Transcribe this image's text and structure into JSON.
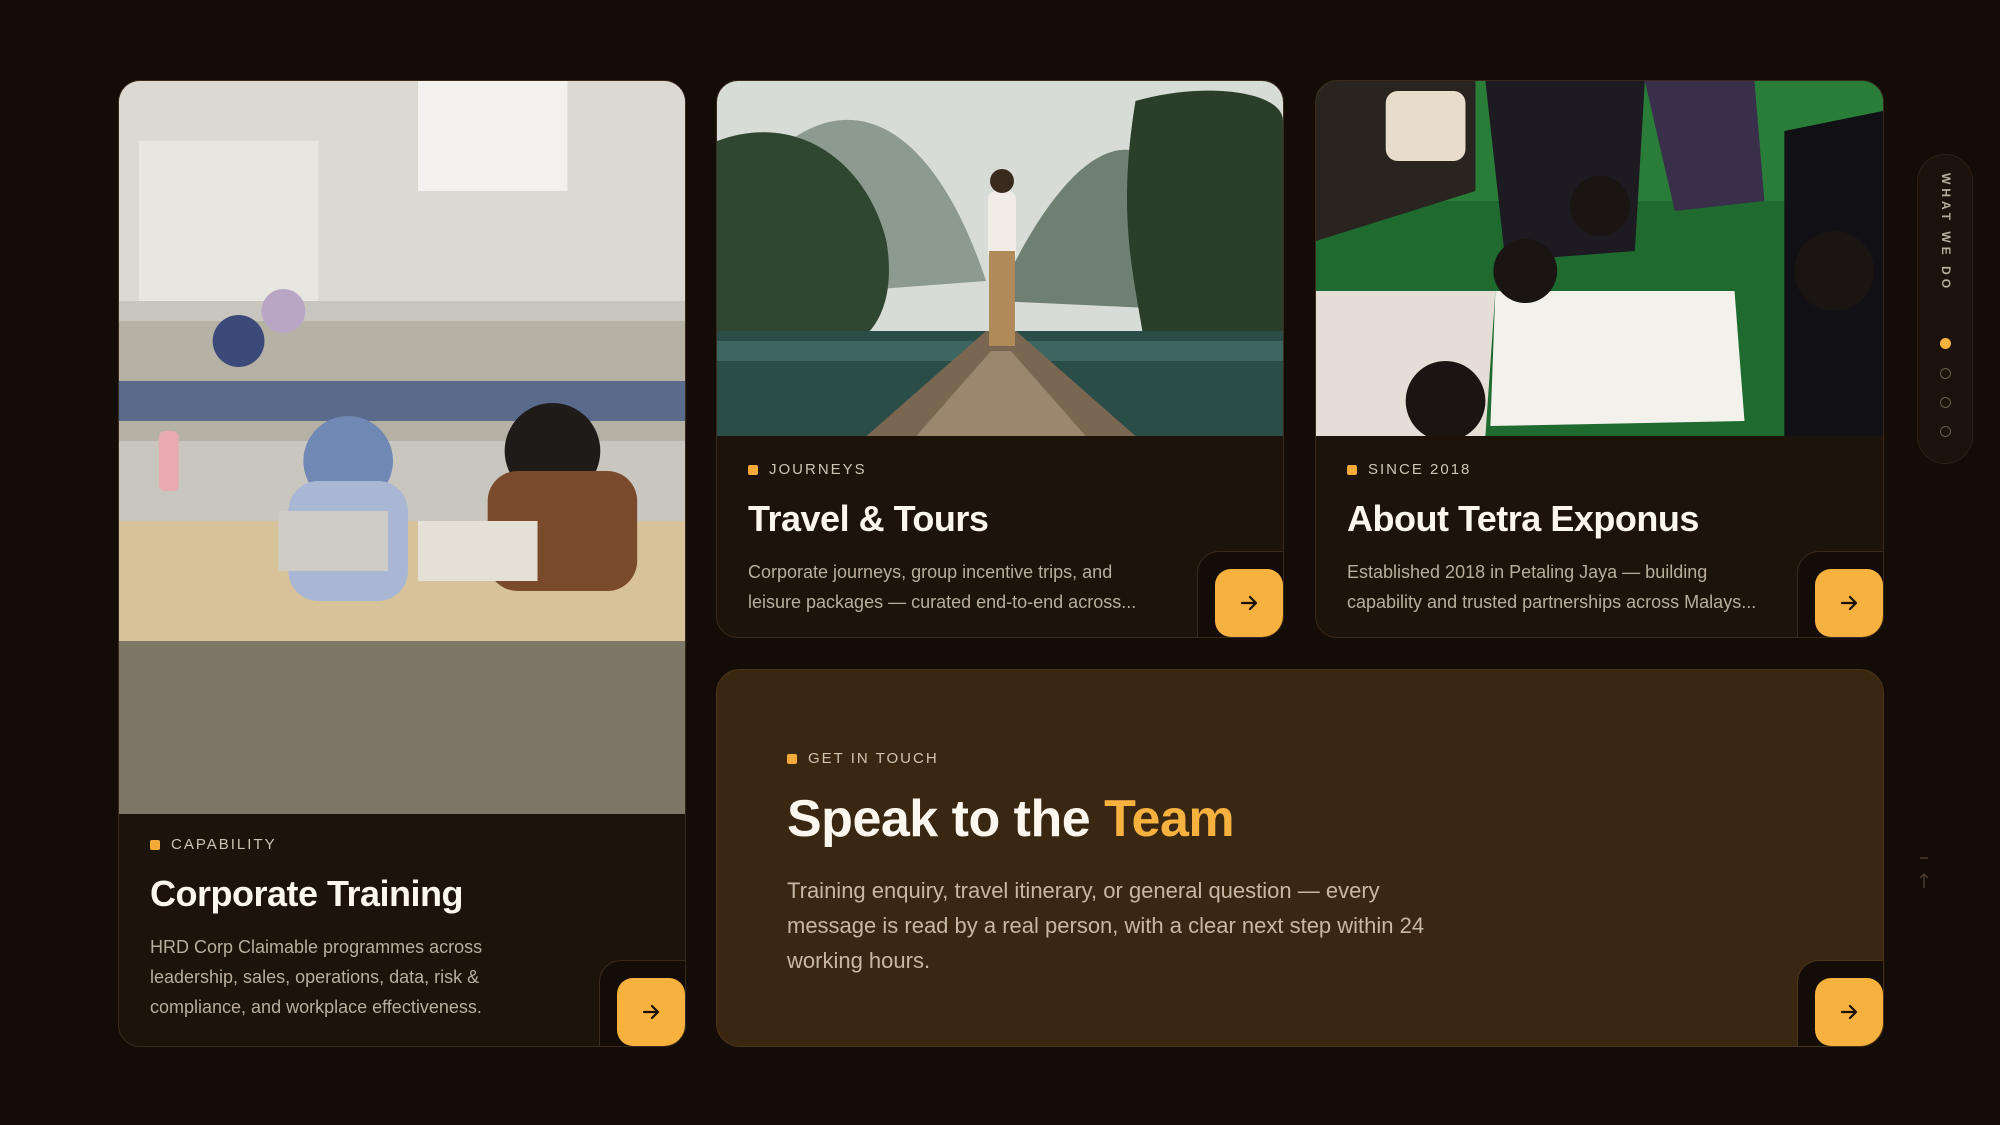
{
  "cards": [
    {
      "eyebrow": "CAPABILITY",
      "title": "Corporate Training",
      "description": "HRD Corp Claimable programmes across leadership, sales, operations, data, risk & compliance, and workplace effectiveness."
    },
    {
      "eyebrow": "JOURNEYS",
      "title": "Travel & Tours",
      "description": "Corporate journeys, group incentive trips, and leisure packages — curated end-to-end across..."
    },
    {
      "eyebrow": "SINCE 2018",
      "title": "About Tetra Exponus",
      "description": "Established 2018 in Petaling Jaya — building capability and trusted partnerships across Malays..."
    }
  ],
  "cta": {
    "eyebrow": "GET IN TOUCH",
    "title_plain": "Speak to the",
    "title_highlight": "Team",
    "description": "Training enquiry, travel itinerary, or general question — every message is read by a real person, with a clear next step within 24 working hours."
  },
  "rail": {
    "label": "WHAT WE DO",
    "active_index": 0,
    "dot_count": 4
  },
  "colors": {
    "background": "#140d07",
    "accent": "#f7b13f",
    "card": "#1c130b",
    "cta_card": "#3a2711"
  },
  "icons": {
    "card_arrow": "arrow-right-icon",
    "back_to_top": "arrow-up-icon"
  }
}
